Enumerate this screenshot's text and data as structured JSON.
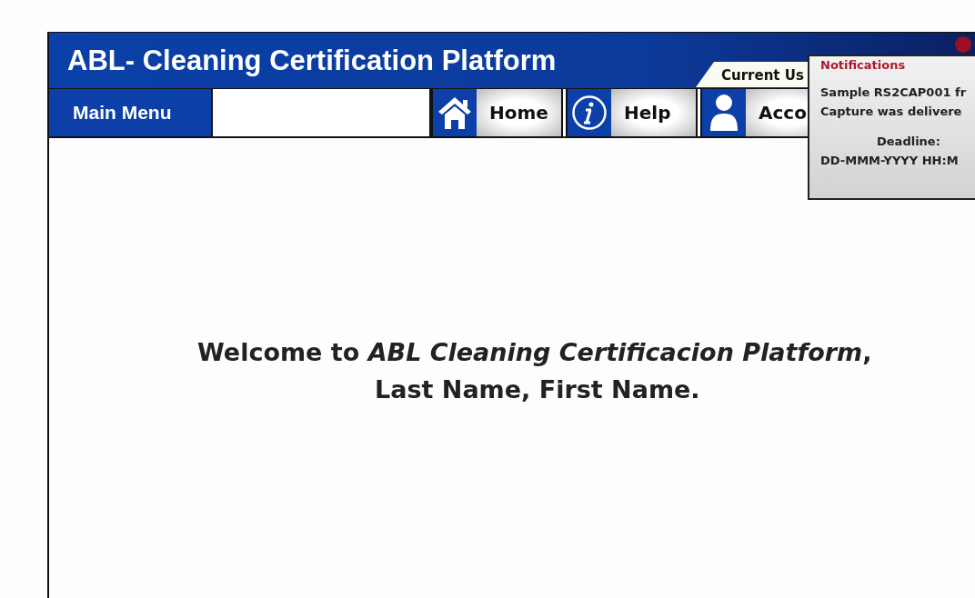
{
  "header": {
    "title": "ABL- Cleaning Certification Platform",
    "current_user_tab": "Current Us"
  },
  "nav": {
    "main_menu": "Main Menu",
    "buttons": [
      {
        "kind": "home",
        "label": "Home"
      },
      {
        "kind": "help",
        "label": "Help"
      },
      {
        "kind": "account",
        "label": "Acco"
      }
    ]
  },
  "notifications": {
    "title": "Notifications",
    "message_lines": [
      "Sample RS2CAP001 fr",
      "Capture was delivere"
    ],
    "deadline_label": "Deadline:",
    "deadline_value": "DD-MMM-YYYY HH:M"
  },
  "welcome": {
    "line_1": "Welcome to *ABL Cleaning Certificacion Platform*,",
    "line_2": "Last Name, First Name."
  }
}
